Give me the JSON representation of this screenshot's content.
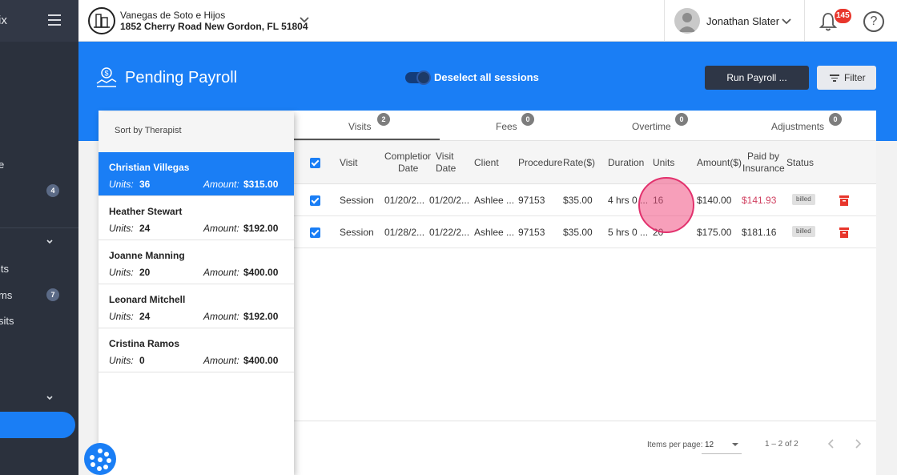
{
  "sidebar": {
    "brand": "ix",
    "items": [
      {
        "label": "e",
        "badge": ""
      },
      {
        "label": "",
        "badge": "4"
      },
      {
        "label": "its",
        "badge": ""
      },
      {
        "label": "ms",
        "badge": "7"
      },
      {
        "label": "sits",
        "badge": ""
      }
    ]
  },
  "header": {
    "company_name": "Vanegas de Soto e Hijos",
    "company_address": "1852 Cherry Road New Gordon, FL 51804",
    "user_name": "Jonathan Slater",
    "notification_count": "145",
    "help_label": "?"
  },
  "banner": {
    "title": "Pending Payroll",
    "toggle_label": "Deselect all sessions",
    "run_payroll_label": "Run Payroll ...",
    "filter_label": "Filter"
  },
  "colors": {
    "primary": "#1a7ef5",
    "sidebar": "#2b313d",
    "danger": "#e8362c"
  },
  "therapist_panel": {
    "header": "Sort by Therapist",
    "units_label": "Units:",
    "amount_label": "Amount:",
    "items": [
      {
        "name": "Christian Villegas",
        "units": "36",
        "amount": "$315.00"
      },
      {
        "name": "Heather Stewart",
        "units": "24",
        "amount": "$192.00"
      },
      {
        "name": "Joanne Manning",
        "units": "20",
        "amount": "$400.00"
      },
      {
        "name": "Leonard Mitchell",
        "units": "24",
        "amount": "$192.00"
      },
      {
        "name": "Cristina Ramos",
        "units": "0",
        "amount": "$400.00"
      }
    ]
  },
  "tabs": [
    {
      "label": "Visits",
      "count": "2"
    },
    {
      "label": "Fees",
      "count": "0"
    },
    {
      "label": "Overtime",
      "count": "0"
    },
    {
      "label": "Adjustments",
      "count": "0"
    }
  ],
  "table": {
    "columns": {
      "visit": "Visit",
      "completion_1": "Completion",
      "completion_2": "Date",
      "visit_date_1": "Visit",
      "visit_date_2": "Date",
      "client": "Client",
      "procedure": "Procedure",
      "rate": "Rate($)",
      "duration": "Duration",
      "units": "Units",
      "amount": "Amount($)",
      "paid_1": "Paid by",
      "paid_2": "Insurance",
      "status": "Status"
    },
    "rows": [
      {
        "visit": "Session",
        "completion": "01/20/2...",
        "visit_date": "01/20/2...",
        "client": "Ashlee ...",
        "procedure": "97153",
        "rate": "$35.00",
        "duration": "4 hrs 0 ...",
        "units": "16",
        "amount": "$140.00",
        "paid": "$141.93",
        "status": "billed"
      },
      {
        "visit": "Session",
        "completion": "01/28/2...",
        "visit_date": "01/22/2...",
        "client": "Ashlee ...",
        "procedure": "97153",
        "rate": "$35.00",
        "duration": "5 hrs 0 ...",
        "units": "20",
        "amount": "$175.00",
        "paid": "$181.16",
        "status": "billed"
      }
    ]
  },
  "pagination": {
    "items_per_page_label": "Items per page:",
    "items_per_page": "12",
    "range": "1 – 2 of 2"
  }
}
